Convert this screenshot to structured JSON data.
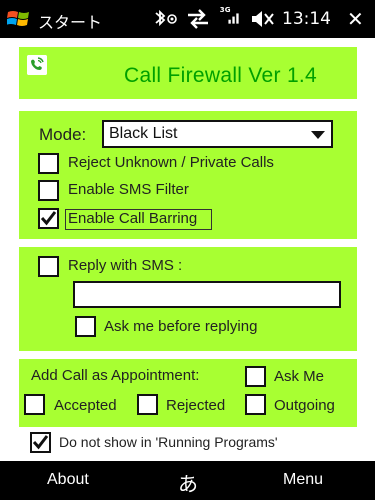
{
  "statusbar": {
    "start_label": "スタート",
    "time": "13:14",
    "network_label": "3G",
    "close_label": "✕"
  },
  "header": {
    "title": "Call Firewall Ver 1.4"
  },
  "filters": {
    "mode_label": "Mode:",
    "mode_value": "Black List",
    "reject_unknown_label": "Reject Unknown / Private Calls",
    "reject_unknown_checked": false,
    "sms_filter_label": "Enable SMS Filter",
    "sms_filter_checked": false,
    "call_barring_label": "Enable Call Barring",
    "call_barring_checked": true
  },
  "reply": {
    "reply_sms_label": "Reply with SMS :",
    "reply_sms_checked": false,
    "reply_text_value": "",
    "ask_before_label": "Ask me before replying",
    "ask_before_checked": false
  },
  "appointment": {
    "heading": "Add Call as Appointment:",
    "ask_me_label": "Ask Me",
    "accepted_label": "Accepted",
    "rejected_label": "Rejected",
    "outgoing_label": "Outgoing"
  },
  "footer": {
    "hide_running_label": "Do not show in 'Running Programs'",
    "hide_running_checked": true
  },
  "softkeys": {
    "left": "About",
    "center": "あ",
    "right": "Menu"
  },
  "colors": {
    "panel": "#a8ff32",
    "title": "#00a000",
    "bar": "#000000"
  }
}
